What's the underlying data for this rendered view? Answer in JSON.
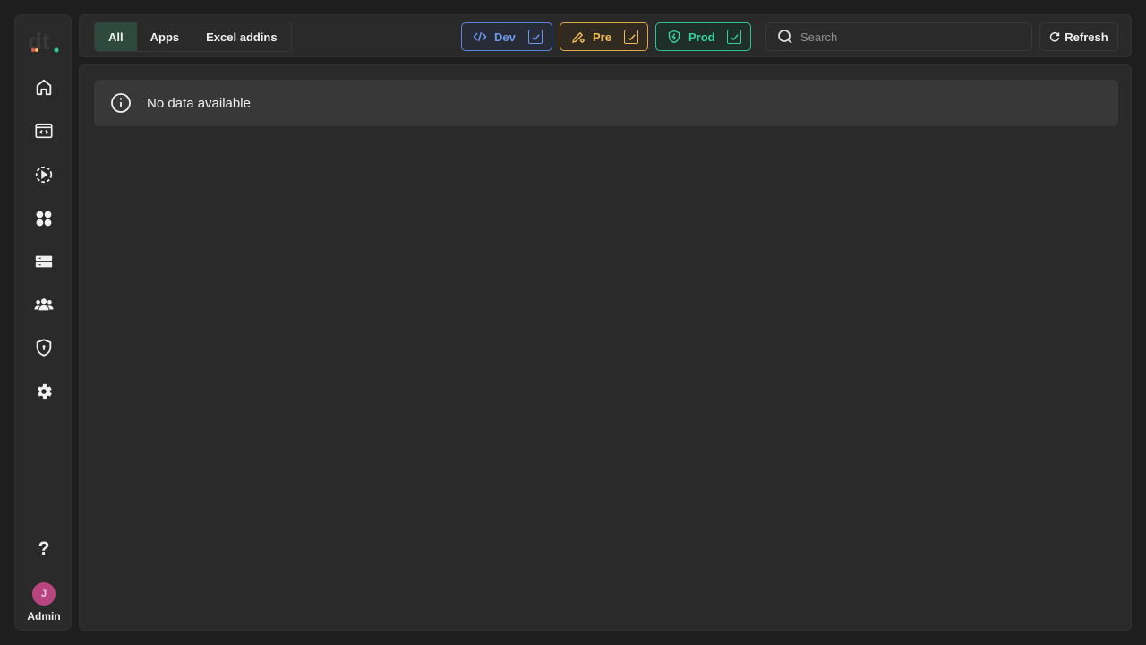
{
  "sidebar": {
    "logo": "dt-logo",
    "items": [
      {
        "name": "home",
        "icon": "home-icon"
      },
      {
        "name": "code-editor",
        "icon": "code-window-icon"
      },
      {
        "name": "runs",
        "icon": "play-circle-icon"
      },
      {
        "name": "apps",
        "icon": "apps-grid-icon"
      },
      {
        "name": "servers",
        "icon": "server-icon"
      },
      {
        "name": "users",
        "icon": "users-icon"
      },
      {
        "name": "security",
        "icon": "shield-icon"
      },
      {
        "name": "settings",
        "icon": "gear-icon"
      }
    ],
    "help_label": "?",
    "avatar_initial": "J",
    "user_role": "Admin"
  },
  "topbar": {
    "filter_tabs": [
      {
        "label": "All",
        "active": true
      },
      {
        "label": "Apps",
        "active": false
      },
      {
        "label": "Excel addins",
        "active": false
      }
    ],
    "environments": [
      {
        "label": "Dev",
        "checked": true,
        "color": "#6b97ec"
      },
      {
        "label": "Pre",
        "checked": true,
        "color": "#f2bb5a"
      },
      {
        "label": "Prod",
        "checked": true,
        "color": "#36cf9e"
      }
    ],
    "search": {
      "placeholder": "Search",
      "value": ""
    },
    "refresh_label": "Refresh"
  },
  "main": {
    "empty_message": "No data available"
  },
  "colors": {
    "background": "#1e1e1e",
    "panel": "#2a2a2a",
    "active_tab": "#2e4a3f",
    "avatar": "#b8457f"
  }
}
